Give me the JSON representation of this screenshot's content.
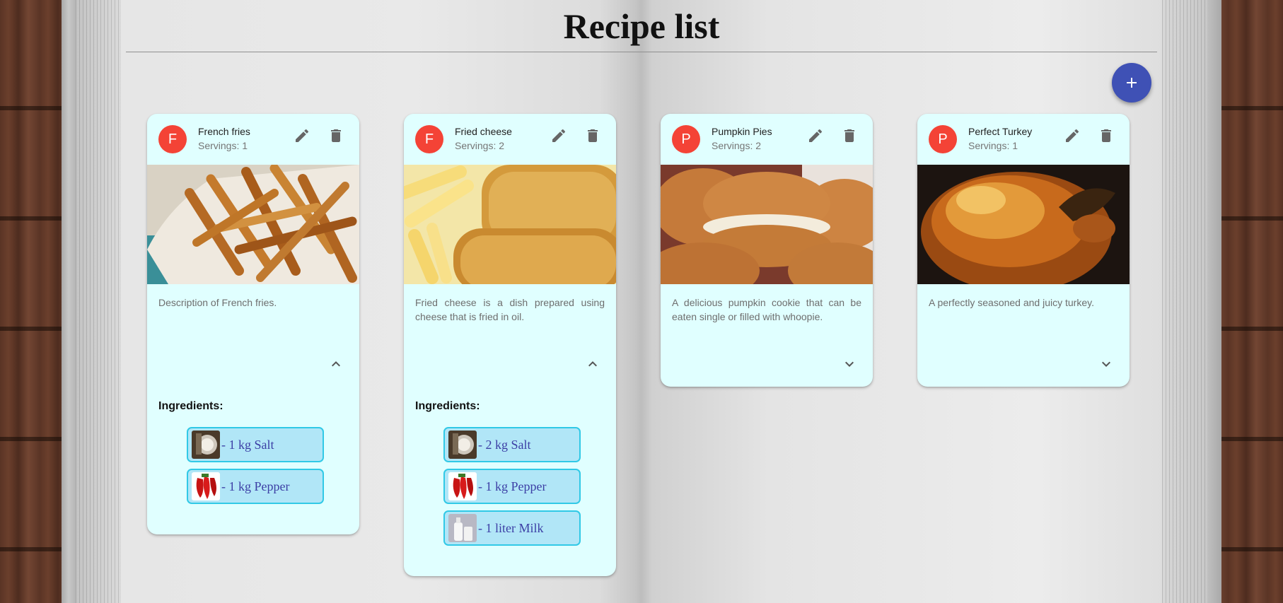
{
  "page": {
    "title": "Recipe list",
    "add_icon": "plus-icon"
  },
  "colors": {
    "card_background": "#e0ffff",
    "avatar": "#f44336",
    "fab": "#3f51b5",
    "chip_border": "#31c9e6",
    "chip_background": "#b1e6f7",
    "chip_text": "#3c3fa5"
  },
  "ingredients_heading": "Ingredients:",
  "recipes": [
    {
      "avatar": "F",
      "name": "French fries",
      "servings": "Servings: 1",
      "description": "Description of French fries.",
      "image": "french-fries-photo",
      "expanded": true,
      "ingredients": [
        {
          "label": "- 1 kg Salt",
          "image": "salt-photo"
        },
        {
          "label": "- 1 kg Pepper",
          "image": "pepper-photo"
        }
      ]
    },
    {
      "avatar": "F",
      "name": "Fried cheese",
      "servings": "Servings: 2",
      "description": "Fried cheese is a dish prepared using cheese that is fried in oil.",
      "image": "fried-cheese-photo",
      "expanded": true,
      "ingredients": [
        {
          "label": "- 2 kg Salt",
          "image": "salt-photo"
        },
        {
          "label": "- 1 kg Pepper",
          "image": "pepper-photo"
        },
        {
          "label": "- 1 liter Milk",
          "image": "milk-photo"
        }
      ]
    },
    {
      "avatar": "P",
      "name": "Pumpkin Pies",
      "servings": "Servings: 2",
      "description": "A delicious pumpkin cookie that can be eaten single or filled with whoopie.",
      "image": "pumpkin-pie-photo",
      "expanded": false,
      "ingredients": []
    },
    {
      "avatar": "P",
      "name": "Perfect Turkey",
      "servings": "Servings: 1",
      "description": "A perfectly seasoned and juicy turkey.",
      "image": "roast-turkey-photo",
      "expanded": false,
      "ingredients": []
    }
  ]
}
